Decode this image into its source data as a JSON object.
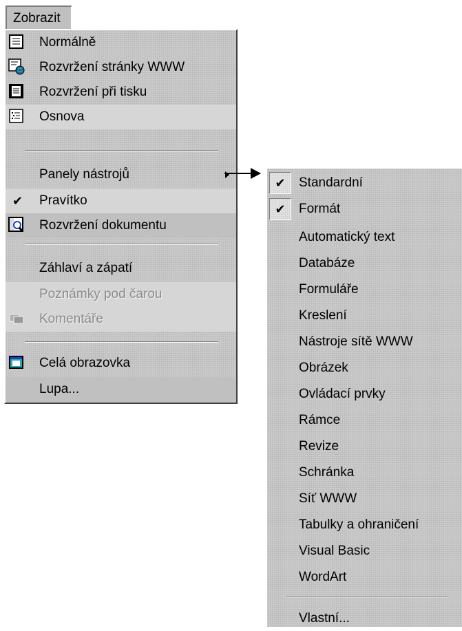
{
  "menubar": {
    "title": "Zobrazit"
  },
  "view_menu": {
    "items": [
      {
        "label": "Normálně",
        "icon": "normal-view-icon"
      },
      {
        "label": "Rozvržení stránky WWW",
        "icon": "web-layout-icon"
      },
      {
        "label": "Rozvržení při tisku",
        "icon": "print-layout-icon"
      },
      {
        "label": "Osnova",
        "icon": "outline-icon"
      },
      {
        "label": "Panely nástrojů",
        "has_submenu": true
      },
      {
        "label": "Pravítko",
        "checked": true
      },
      {
        "label": "Rozvržení dokumentu",
        "icon": "document-map-icon"
      },
      {
        "label": "Záhlaví a zápatí"
      },
      {
        "label": "Poznámky pod čarou",
        "disabled": true
      },
      {
        "label": "Komentáře",
        "icon": "comments-icon",
        "disabled": true
      },
      {
        "label": "Celá obrazovka",
        "icon": "full-screen-icon"
      },
      {
        "label": "Lupa..."
      }
    ]
  },
  "toolbars_submenu": {
    "items": [
      {
        "label": "Standardní",
        "checked": true
      },
      {
        "label": "Formát",
        "checked": true
      },
      {
        "label": "Automatický text"
      },
      {
        "label": "Databáze"
      },
      {
        "label": "Formuláře"
      },
      {
        "label": "Kreslení"
      },
      {
        "label": "Nástroje sítě WWW"
      },
      {
        "label": "Obrázek"
      },
      {
        "label": "Ovládací prvky"
      },
      {
        "label": "Rámce"
      },
      {
        "label": "Revize"
      },
      {
        "label": "Schránka"
      },
      {
        "label": "Síť WWW"
      },
      {
        "label": "Tabulky a ohraničení"
      },
      {
        "label": "Visual Basic"
      },
      {
        "label": "WordArt"
      },
      {
        "label": "Vlastní..."
      }
    ]
  },
  "colors": {
    "menu_face": "#c0c0c0",
    "stipple": "#cacaca",
    "disabled_text": "#8a8a8a"
  }
}
